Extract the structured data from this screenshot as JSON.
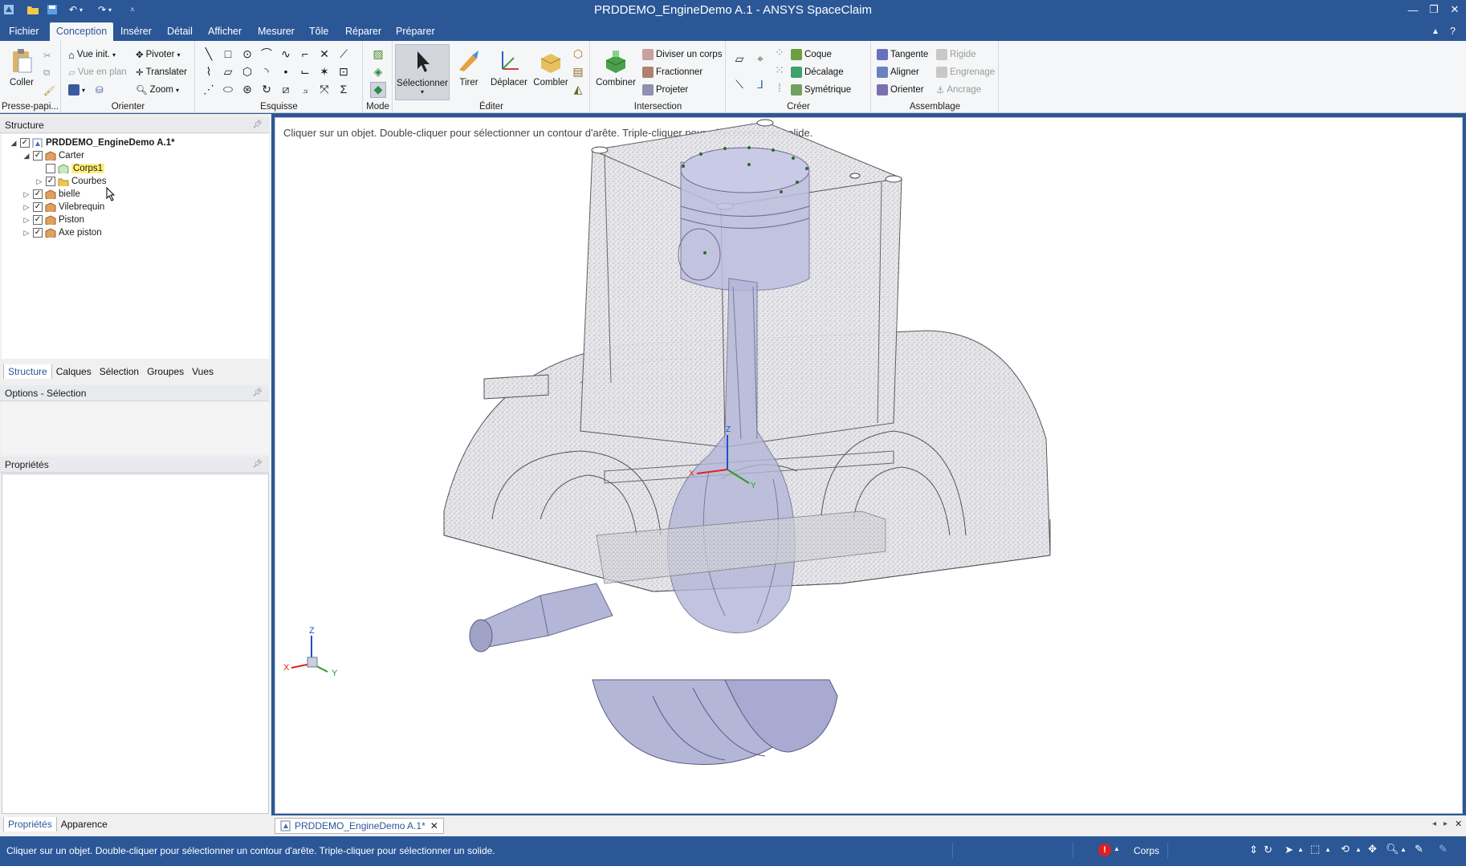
{
  "window": {
    "title": "PRDDEMO_EngineDemo A.1 - ANSYS SpaceClaim"
  },
  "menu_tabs": [
    "Fichier",
    "Conception",
    "Insérer",
    "Détail",
    "Afficher",
    "Mesurer",
    "Tôle",
    "Réparer",
    "Préparer"
  ],
  "ribbon": {
    "clipboard": {
      "paste": "Coller",
      "group": "Presse-papi..."
    },
    "orient": {
      "home_view": "Vue init.",
      "plan_view": "Vue en plan",
      "pivot": "Pivoter",
      "translate": "Translater",
      "zoom": "Zoom",
      "group": "Orienter"
    },
    "sketch": {
      "group": "Esquisse"
    },
    "mode": {
      "group": "Mode"
    },
    "edit": {
      "select": "Sélectionner",
      "pull": "Tirer",
      "move": "Déplacer",
      "fill": "Combler",
      "group": "Éditer"
    },
    "intersect": {
      "combine": "Combiner",
      "split_body": "Diviser un corps",
      "split": "Fractionner",
      "project": "Projeter",
      "group": "Intersection"
    },
    "create": {
      "shell": "Coque",
      "offset": "Décalage",
      "mirror": "Symétrique",
      "group": "Créer"
    },
    "assembly": {
      "tangent": "Tangente",
      "align": "Aligner",
      "orient": "Orienter",
      "rigid": "Rigide",
      "gear": "Engrenage",
      "anchor": "Ancrage",
      "group": "Assemblage"
    }
  },
  "structure_panel": {
    "title": "Structure",
    "tree": [
      {
        "label": "PRDDEMO_EngineDemo A.1*",
        "level": 0,
        "checked": true,
        "expanded": true,
        "bold": true
      },
      {
        "label": "Carter",
        "level": 1,
        "checked": true,
        "expanded": true
      },
      {
        "label": "Corps1",
        "level": 2,
        "checked": false,
        "highlighted": true
      },
      {
        "label": "Courbes",
        "level": 2,
        "checked": true,
        "expanded": false
      },
      {
        "label": "bielle",
        "level": 1,
        "checked": true,
        "expanded": false
      },
      {
        "label": "Vilebrequin",
        "level": 1,
        "checked": true,
        "expanded": false
      },
      {
        "label": "Piston",
        "level": 1,
        "checked": true,
        "expanded": false
      },
      {
        "label": "Axe piston",
        "level": 1,
        "checked": true,
        "expanded": false
      }
    ],
    "tabs": [
      "Structure",
      "Calques",
      "Sélection",
      "Groupes",
      "Vues"
    ]
  },
  "options_panel": {
    "title": "Options - Sélection"
  },
  "properties_panel": {
    "title": "Propriétés",
    "tabs": [
      "Propriétés",
      "Apparence"
    ]
  },
  "viewport": {
    "hint": "Cliquer sur un objet. Double-cliquer pour sélectionner un contour d'arête. Triple-cliquer pour sélectionner un solide.",
    "triad": {
      "x": "X",
      "y": "Y",
      "z": "Z"
    },
    "axis_colors": {
      "x": "#e02020",
      "y": "#2a9a2a",
      "z": "#2050d0"
    }
  },
  "document_tab": {
    "label": "PRDDEMO_EngineDemo A.1*"
  },
  "statusbar": {
    "message": "Cliquer sur un objet. Double-cliquer pour sélectionner un contour d'arête. Triple-cliquer pour sélectionner un solide.",
    "selection_type": "Corps"
  },
  "colors": {
    "brand": "#2b5797",
    "ribbon_bg": "#f5f6f7",
    "part_fill": "#b4b6d8",
    "highlight": "#fff07a"
  }
}
